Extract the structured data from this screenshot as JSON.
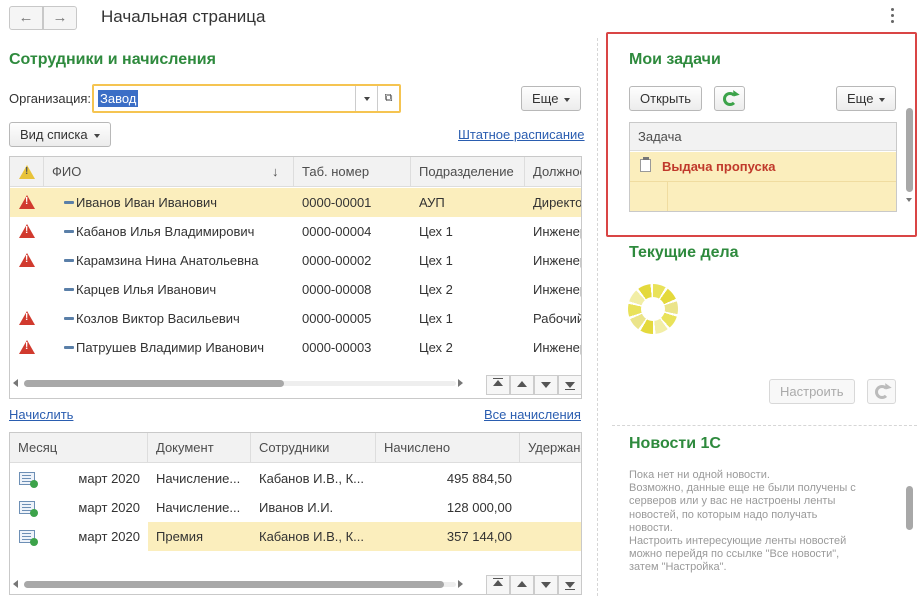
{
  "header": {
    "title": "Начальная страница",
    "back_icon": "←",
    "forward_icon": "→"
  },
  "employees": {
    "title": "Сотрудники и начисления",
    "org_label": "Организация:",
    "org_value": "Завод",
    "more_button": "Еще",
    "list_view_button": "Вид списка",
    "staff_schedule_link": "Штатное расписание",
    "columns": [
      "ФИО",
      "Таб. номер",
      "Подразделение",
      "Должнос"
    ],
    "sort_indicator": "↓",
    "rows": [
      {
        "warn": true,
        "name": "Иванов Иван Иванович",
        "tab": "0000-00001",
        "dept": "АУП",
        "pos": "Директор",
        "selected": true
      },
      {
        "warn": true,
        "name": "Кабанов Илья Владимирович",
        "tab": "0000-00004",
        "dept": "Цех 1",
        "pos": "Инженер",
        "selected": false
      },
      {
        "warn": true,
        "name": "Карамзина Нина Анатольевна",
        "tab": "0000-00002",
        "dept": "Цех 1",
        "pos": "Инженер",
        "selected": false
      },
      {
        "warn": false,
        "name": "Карцев Илья Иванович",
        "tab": "0000-00008",
        "dept": "Цех 2",
        "pos": "Инженер",
        "selected": false
      },
      {
        "warn": true,
        "name": "Козлов Виктор Васильевич",
        "tab": "0000-00005",
        "dept": "Цех 1",
        "pos": "Рабочий",
        "selected": false
      },
      {
        "warn": true,
        "name": "Патрушев Владимир Иванович",
        "tab": "0000-00003",
        "dept": "Цех 2",
        "pos": "Инженер",
        "selected": false
      }
    ]
  },
  "accruals": {
    "accrue_link": "Начислить",
    "all_accruals_link": "Все начисления",
    "columns": [
      "Месяц",
      "Документ",
      "Сотрудники",
      "Начислено",
      "Удержано"
    ],
    "rows": [
      {
        "month": "март 2020",
        "doc": "Начисление...",
        "employees": "Кабанов И.В., К...",
        "amount": "495 884,50",
        "selected": false
      },
      {
        "month": "март 2020",
        "doc": "Начисление...",
        "employees": "Иванов И.И.",
        "amount": "128 000,00",
        "selected": false
      },
      {
        "month": "март 2020",
        "doc": "Премия",
        "employees": "Кабанов И.В., К...",
        "amount": "357 144,00",
        "selected": true
      }
    ]
  },
  "tasks": {
    "title": "Мои задачи",
    "open_button": "Открыть",
    "more_button": "Еще",
    "column": "Задача",
    "rows": [
      "Выдача пропуска"
    ]
  },
  "current": {
    "title": "Текущие дела",
    "configure_button": "Настроить"
  },
  "news": {
    "title": "Новости 1С",
    "lines": [
      "Пока нет ни одной новости.",
      "Возможно, данные еще не были получены с",
      "серверов или у вас не настроены ленты",
      "новостей, по которым надо получать",
      "новости.",
      "Настроить интересующие ленты новостей",
      "можно перейдя по ссылке \"Все новости\",",
      "затем \"Настройка\"."
    ]
  },
  "colors": {
    "accent_green": "#2e8a3d",
    "selection": "#fbeebd",
    "focus_frame": "#d94545",
    "task_text": "#c0392b"
  }
}
